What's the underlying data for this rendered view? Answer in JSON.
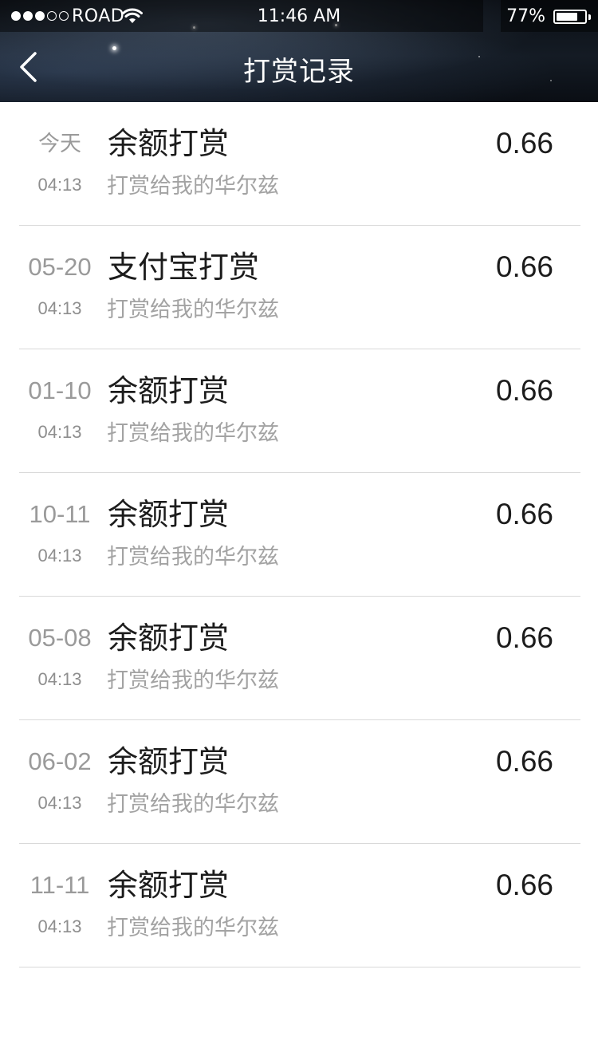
{
  "status_bar": {
    "signal_filled": 3,
    "signal_total": 5,
    "carrier": "ROAD",
    "time": "11:46 AM",
    "battery_percent_text": "77%",
    "battery_level": 0.77
  },
  "nav": {
    "back_icon": "chevron-left-icon",
    "title": "打赏记录"
  },
  "records": [
    {
      "date": "今天",
      "time": "04:13",
      "title": "余额打赏",
      "description": "打赏给我的华尔兹",
      "amount": "0.66"
    },
    {
      "date": "05-20",
      "time": "04:13",
      "title": "支付宝打赏",
      "description": "打赏给我的华尔兹",
      "amount": "0.66"
    },
    {
      "date": "01-10",
      "time": "04:13",
      "title": "余额打赏",
      "description": "打赏给我的华尔兹",
      "amount": "0.66"
    },
    {
      "date": "10-11",
      "time": "04:13",
      "title": "余额打赏",
      "description": "打赏给我的华尔兹",
      "amount": "0.66"
    },
    {
      "date": "05-08",
      "time": "04:13",
      "title": "余额打赏",
      "description": "打赏给我的华尔兹",
      "amount": "0.66"
    },
    {
      "date": "06-02",
      "time": "04:13",
      "title": "余额打赏",
      "description": "打赏给我的华尔兹",
      "amount": "0.66"
    },
    {
      "date": "11-11",
      "time": "04:13",
      "title": "余额打赏",
      "description": "打赏给我的华尔兹",
      "amount": "0.66"
    }
  ],
  "colors": {
    "header_background": "#10161e",
    "list_background": "#ffffff",
    "primary_text": "#1c1c1c",
    "secondary_text": "#9a9a9a",
    "divider": "#d9d9d9"
  }
}
